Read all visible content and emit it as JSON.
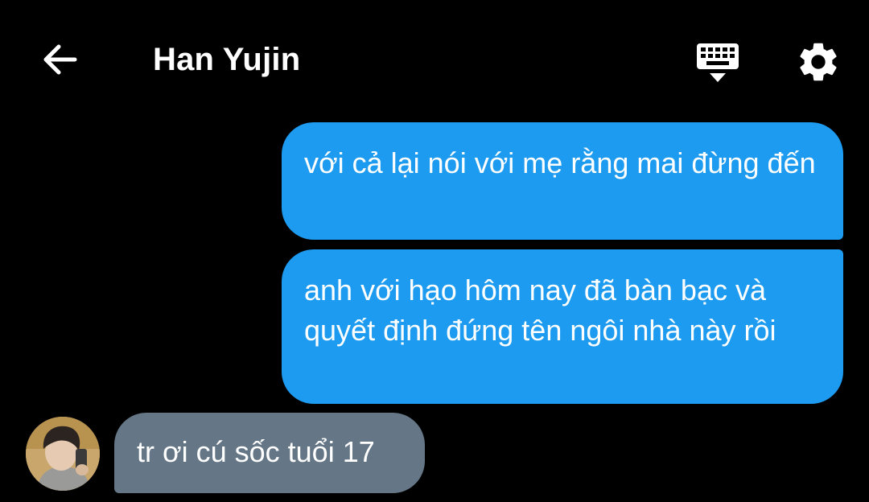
{
  "header": {
    "title": "Han Yujin",
    "back_icon": "arrow-left-icon",
    "keyboard_icon": "keyboard-hide-icon",
    "settings_icon": "gear-icon"
  },
  "messages": [
    {
      "direction": "sent",
      "text": "với cả lại nói với mẹ rằng mai đừng đến"
    },
    {
      "direction": "sent",
      "text": "anh với hạo hôm nay đã bàn bạc và quyết định đứng tên ngôi nhà này rồi"
    },
    {
      "direction": "received",
      "text": "tr ơi cú sốc tuổi 17"
    }
  ],
  "colors": {
    "background": "#000000",
    "sent_bubble": "#1d9bf0",
    "received_bubble": "#657786",
    "text": "#ffffff"
  }
}
